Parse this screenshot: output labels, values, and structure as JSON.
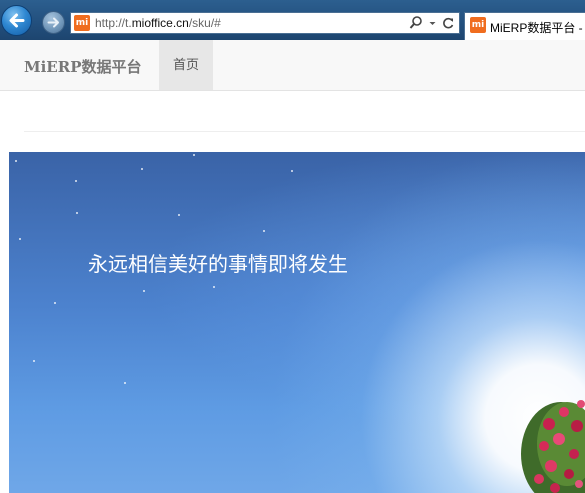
{
  "browser": {
    "url_prefix": "http://t.",
    "url_domain": "mioffice.cn",
    "url_path": "/sku/#",
    "tab_title": "MiERP数据平台 -",
    "favicon_text": "mi"
  },
  "navbar": {
    "brand": "MiERP数据平台",
    "home_label": "首页"
  },
  "hero": {
    "text": "永远相信美好的事情即将发生"
  },
  "colors": {
    "chrome": "#23507e",
    "accent": "#f06d1f",
    "navbar_bg": "#f8f8f8",
    "hero_blue": "#4c82ce"
  },
  "icons": [
    "back-arrow-icon",
    "forward-arrow-icon",
    "search-icon",
    "dropdown-icon",
    "refresh-icon",
    "favicon-icon"
  ]
}
